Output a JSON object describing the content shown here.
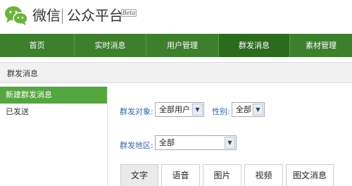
{
  "header": {
    "brand": "微信",
    "product": "公众平台",
    "badge": "Beta"
  },
  "nav": {
    "items": [
      "首页",
      "实时消息",
      "用户管理",
      "群发消息",
      "素材管理"
    ],
    "active_index": 3
  },
  "section": {
    "title": "群发消息"
  },
  "sidebar": {
    "items": [
      "新建群发消息",
      "已发送"
    ],
    "active_index": 0
  },
  "form": {
    "target_label": "群发对象:",
    "target_value": "全部用户",
    "gender_label": "性别:",
    "gender_value": "全部",
    "region_label": "群发地区:",
    "region_value": "全部"
  },
  "tabs": {
    "items": [
      "文字",
      "语音",
      "图片",
      "视频",
      "图文消息"
    ],
    "active_index": 0
  },
  "colors": {
    "nav_bg": "#3d7f2c",
    "nav_active": "#2c6a1e",
    "sidebar_active": "#55a640",
    "label_blue": "#3a66a8"
  }
}
